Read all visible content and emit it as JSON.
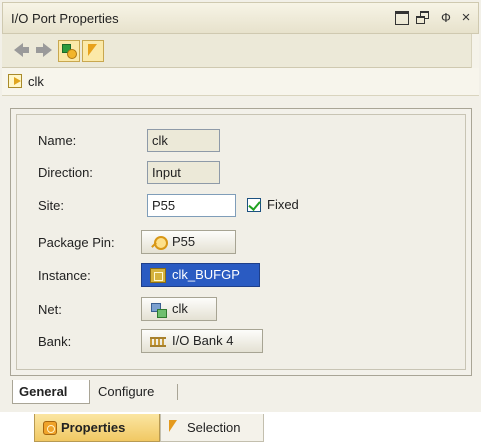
{
  "window": {
    "title": "I/O Port Properties",
    "buttons": {
      "maximize_icon": "maximize-icon",
      "restore_icon": "restore-icon",
      "pin_glyph": "Ф",
      "close_glyph": "×"
    }
  },
  "toolbar": {
    "items": [
      "back-arrow-icon",
      "forward-arrow-icon",
      "show-objects-icon",
      "select-cursor-icon"
    ]
  },
  "object": {
    "name": "clk",
    "icon": "port-icon"
  },
  "properties": {
    "name": {
      "label": "Name:",
      "value": "clk"
    },
    "direction": {
      "label": "Direction:",
      "value": "Input"
    },
    "site": {
      "label": "Site:",
      "value": "P55",
      "fixed_label": "Fixed",
      "fixed_checked": true
    },
    "package_pin": {
      "label": "Package Pin:",
      "value": "P55"
    },
    "instance": {
      "label": "Instance:",
      "value": "clk_BUFGP"
    },
    "net": {
      "label": "Net:",
      "value": "clk"
    },
    "bank": {
      "label": "Bank:",
      "value": "I/O Bank 4"
    }
  },
  "inner_tabs": {
    "general": "General",
    "configure": "Configure",
    "active": "General"
  },
  "view_tabs": {
    "properties": "Properties",
    "selection": "Selection",
    "active": "Properties"
  },
  "colors": {
    "selection": "#2a5bc2",
    "active_view_tab": "#f1c863",
    "check": "#21a121"
  }
}
